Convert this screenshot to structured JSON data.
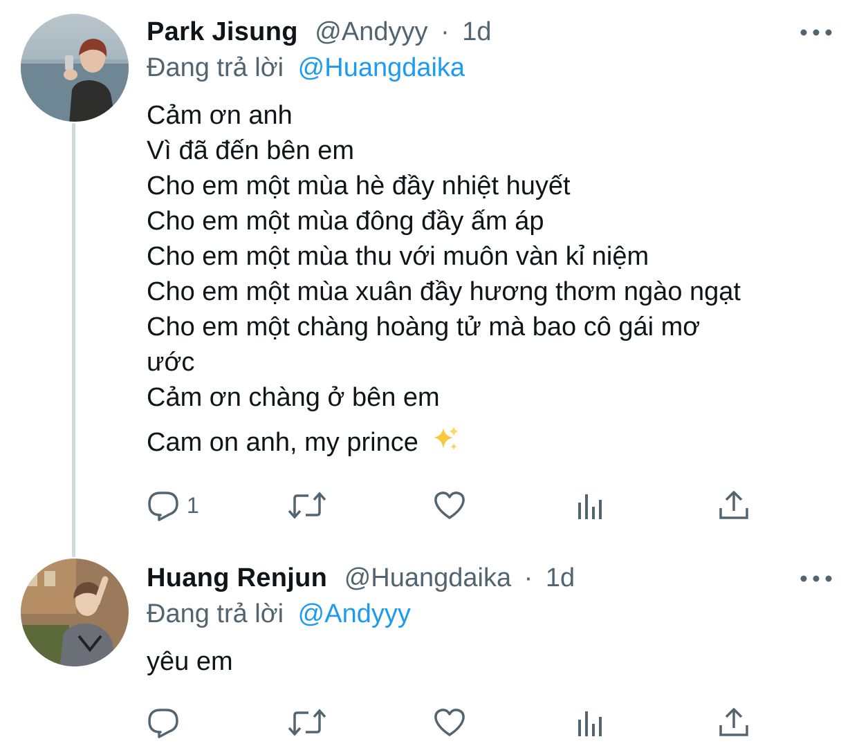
{
  "colors": {
    "accent": "#1d9bf0",
    "muted": "#536471",
    "text": "#0f1419",
    "thread": "#cfd9de"
  },
  "tweets": [
    {
      "name": "Park Jisung",
      "handle": "@Andyyy",
      "separator": "·",
      "time": "1d",
      "replying_label": "Đang trả lời",
      "replying_to": "@Huangdaika",
      "lines": [
        "Cảm ơn anh",
        "Vì đã đến bên em",
        "Cho em một mùa hè đầy nhiệt huyết",
        "Cho em một mùa đông đầy ấm áp",
        "Cho em một mùa thu với muôn vàn kỉ niệm",
        "Cho em một mùa xuân đầy hương thơm ngào ngạt",
        "Cho em một chàng hoàng tử mà bao cô gái mơ",
        "ước",
        "Cảm ơn chàng ở bên em"
      ],
      "closing": "Cam on anh, my prince",
      "emoji": "sparkles",
      "reply_count": "1",
      "icons": [
        "reply-icon",
        "retweet-icon",
        "like-icon",
        "analytics-icon",
        "share-icon",
        "more-icon"
      ]
    },
    {
      "name": "Huang Renjun",
      "handle": "@Huangdaika",
      "separator": "·",
      "time": "1d",
      "replying_label": "Đang trả lời",
      "replying_to": "@Andyyy",
      "lines": [
        "yêu em"
      ],
      "icons": [
        "reply-icon",
        "retweet-icon",
        "like-icon",
        "analytics-icon",
        "share-icon",
        "more-icon"
      ]
    }
  ]
}
